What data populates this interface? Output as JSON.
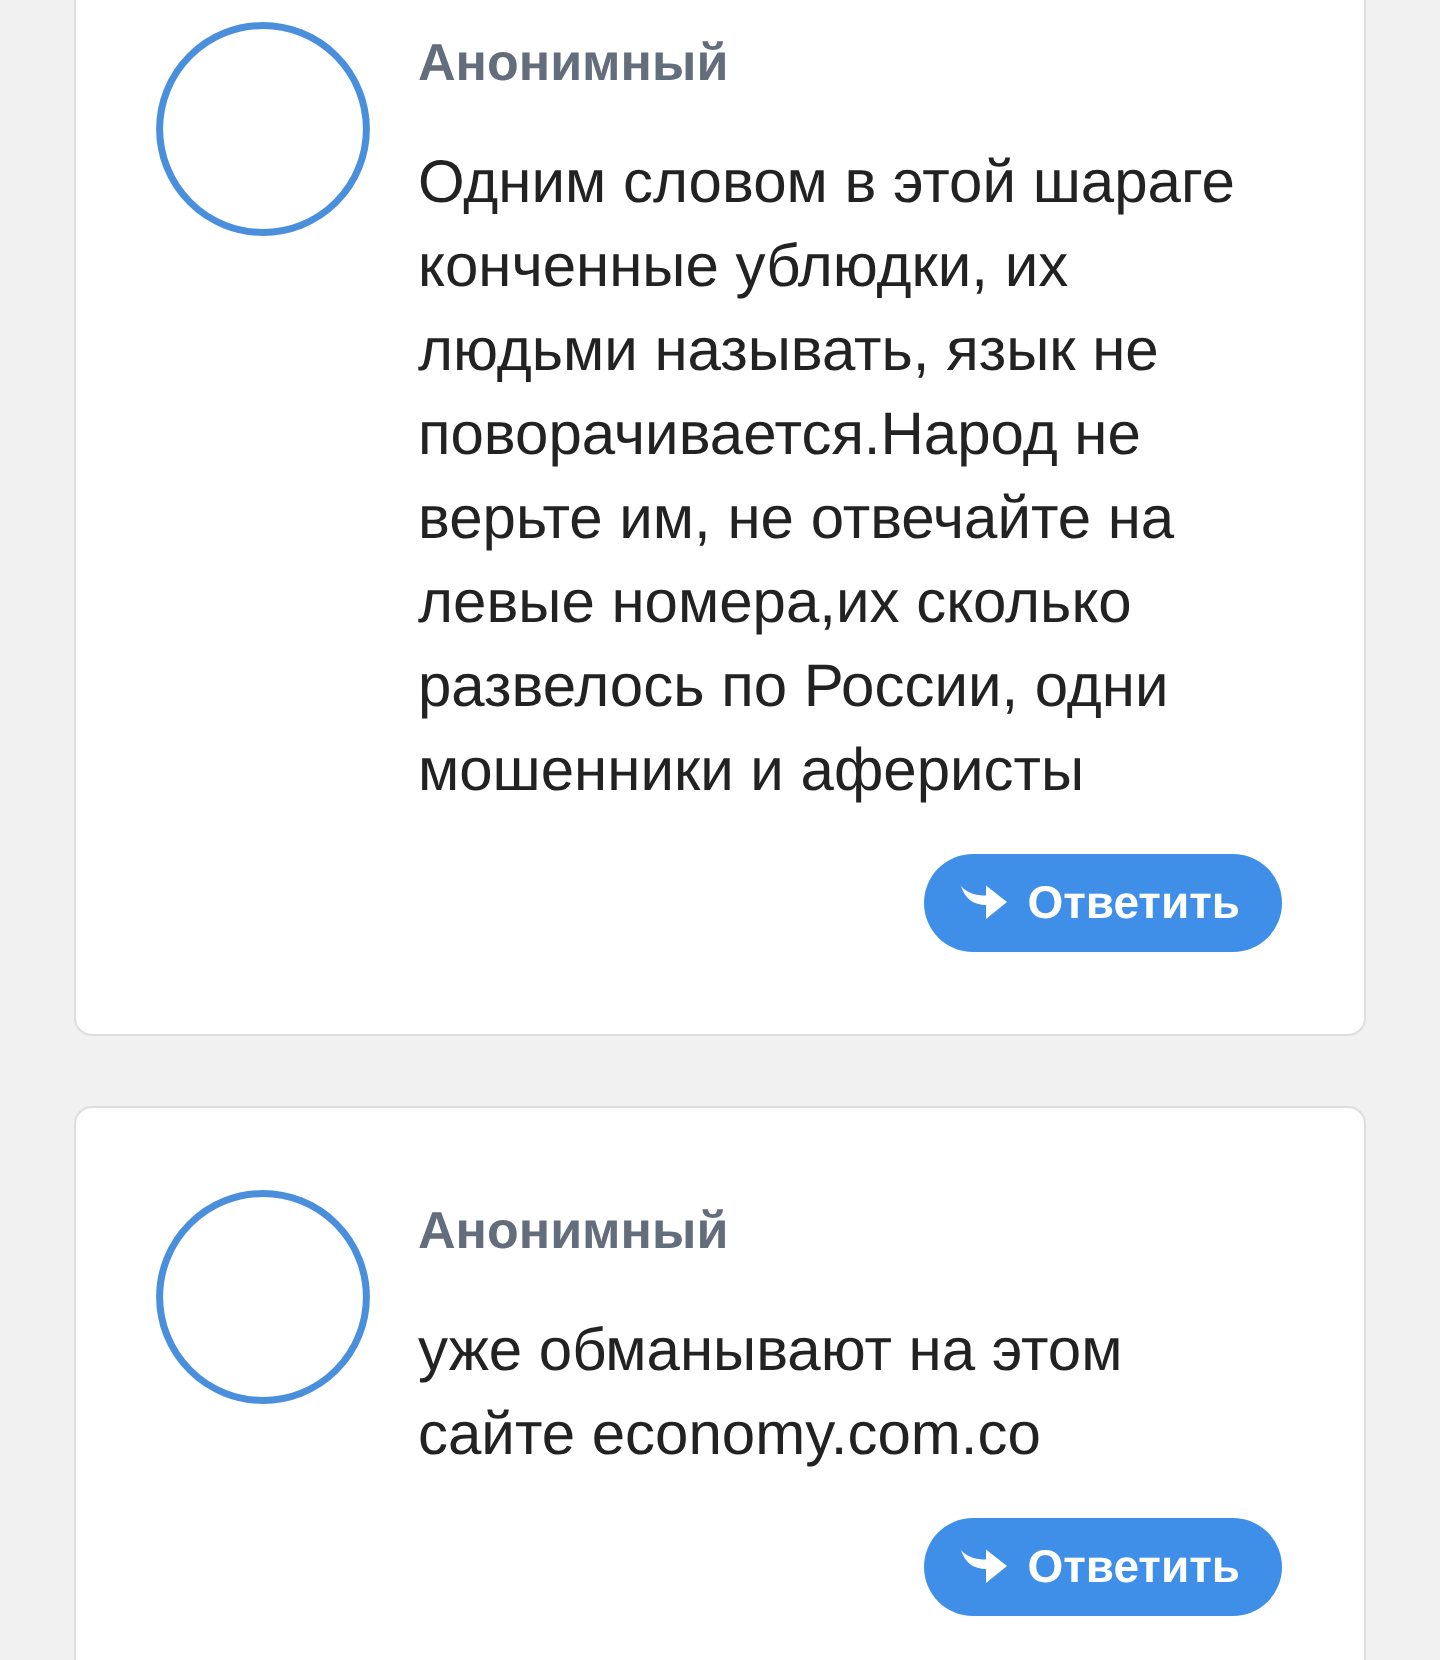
{
  "comments": [
    {
      "author": "Анонимный",
      "text": "Одним словом в этой шараге конченные ублюдки, их людьми называть, язык не поворачивается.Народ не верьте им, не отвечайте на левые номера,их сколько развелось по России, одни мошенники и аферисты",
      "reply_button": "Ответить"
    },
    {
      "author": "Анонимный",
      "text": "уже обманывают на этом сайте economy.com.co",
      "reply_button": "Ответить"
    }
  ]
}
